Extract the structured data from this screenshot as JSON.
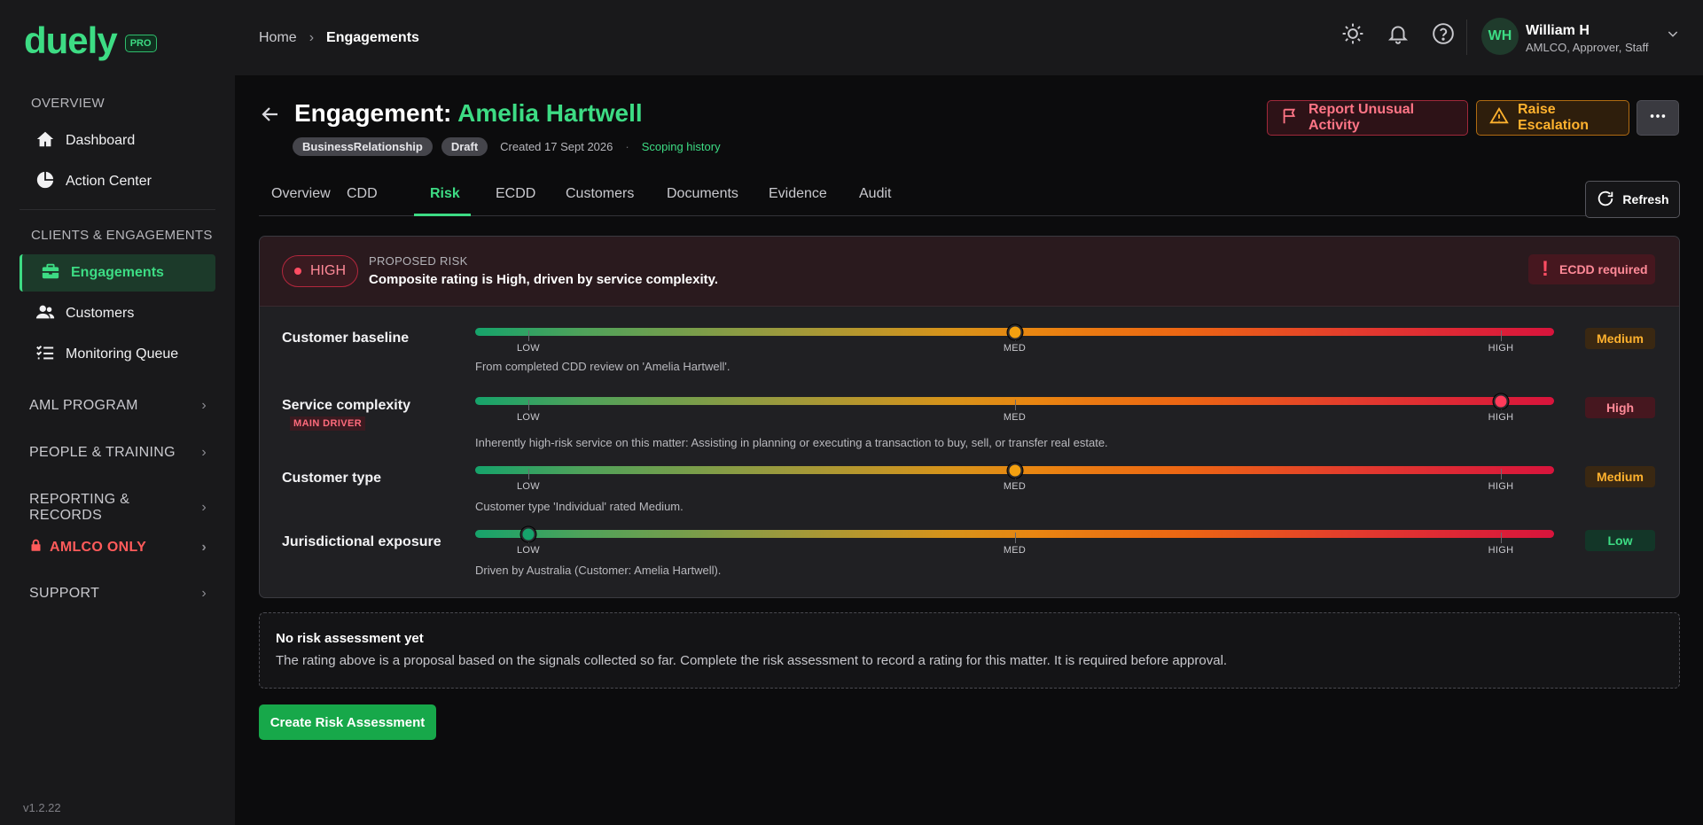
{
  "brand": {
    "name": "duely",
    "badge": "PRO"
  },
  "sidebar": {
    "overview_title": "OVERVIEW",
    "overview_items": [
      {
        "label": "Dashboard",
        "icon": "home-icon"
      },
      {
        "label": "Action Center",
        "icon": "pie-chart-icon"
      }
    ],
    "clients_title": "CLIENTS & ENGAGEMENTS",
    "clients_items": [
      {
        "label": "Engagements",
        "icon": "briefcase-icon",
        "active": true
      },
      {
        "label": "Customers",
        "icon": "users-icon"
      },
      {
        "label": "Monitoring Queue",
        "icon": "checklist-icon"
      }
    ],
    "groups": [
      {
        "label": "AML PROGRAM"
      },
      {
        "label": "PEOPLE & TRAINING"
      },
      {
        "label": "REPORTING & RECORDS"
      },
      {
        "label": "AMLCO ONLY",
        "icon": "lock-icon",
        "color": "#ff5b5b"
      },
      {
        "label": "SUPPORT"
      }
    ],
    "version": "v1.2.22"
  },
  "breadcrumb": {
    "home": "Home",
    "current": "Engagements"
  },
  "user": {
    "initials": "WH",
    "name": "William H",
    "roles": "AMLCO, Approver, Staff"
  },
  "engagement": {
    "title_prefix": "Engagement:",
    "title_name": "Amelia Hartwell",
    "tags": [
      "BusinessRelationship",
      "Draft"
    ],
    "created": "Created 17 Sept 2026",
    "separator": "·",
    "scoping_link": "Scoping history"
  },
  "actions": {
    "report": "Report Unusual Activity",
    "raise": "Raise Escalation",
    "refresh": "Refresh"
  },
  "tabs": [
    "Overview",
    "CDD",
    "Risk",
    "ECDD",
    "Customers",
    "Documents",
    "Evidence",
    "Audit"
  ],
  "active_tab": "Risk",
  "risk": {
    "rating": "HIGH",
    "proposed_label": "PROPOSED RISK",
    "summary": "Composite rating is High, driven by service complexity.",
    "ecdd_badge": "ECDD required",
    "scale_labels": [
      "LOW",
      "MED",
      "HIGH"
    ],
    "factors": [
      {
        "name": "Customer baseline",
        "level": "Medium",
        "position": 0.5,
        "description": "From completed CDD review on 'Amelia Hartwell'."
      },
      {
        "name": "Service complexity",
        "level": "High",
        "position": 1.0,
        "driver": "MAIN DRIVER",
        "description": "Inherently high-risk service on this matter: Assisting in planning or executing a transaction to buy, sell, or transfer real estate."
      },
      {
        "name": "Customer type",
        "level": "Medium",
        "position": 0.5,
        "description": "Customer type 'Individual' rated Medium."
      },
      {
        "name": "Jurisdictional exposure",
        "level": "Low",
        "position": 0.0,
        "description": "Driven by Australia (Customer: Amelia Hartwell)."
      }
    ]
  },
  "notice": {
    "title": "No risk assessment yet",
    "text": "The rating above is a proposal based on the signals collected so far. Complete the risk assessment to record a rating for this matter. It is required before approval."
  },
  "create_button": "Create Risk Assessment",
  "colors": {
    "accent": "#3ddc84",
    "danger": "#ff4d63",
    "warning": "#ffb22e"
  }
}
